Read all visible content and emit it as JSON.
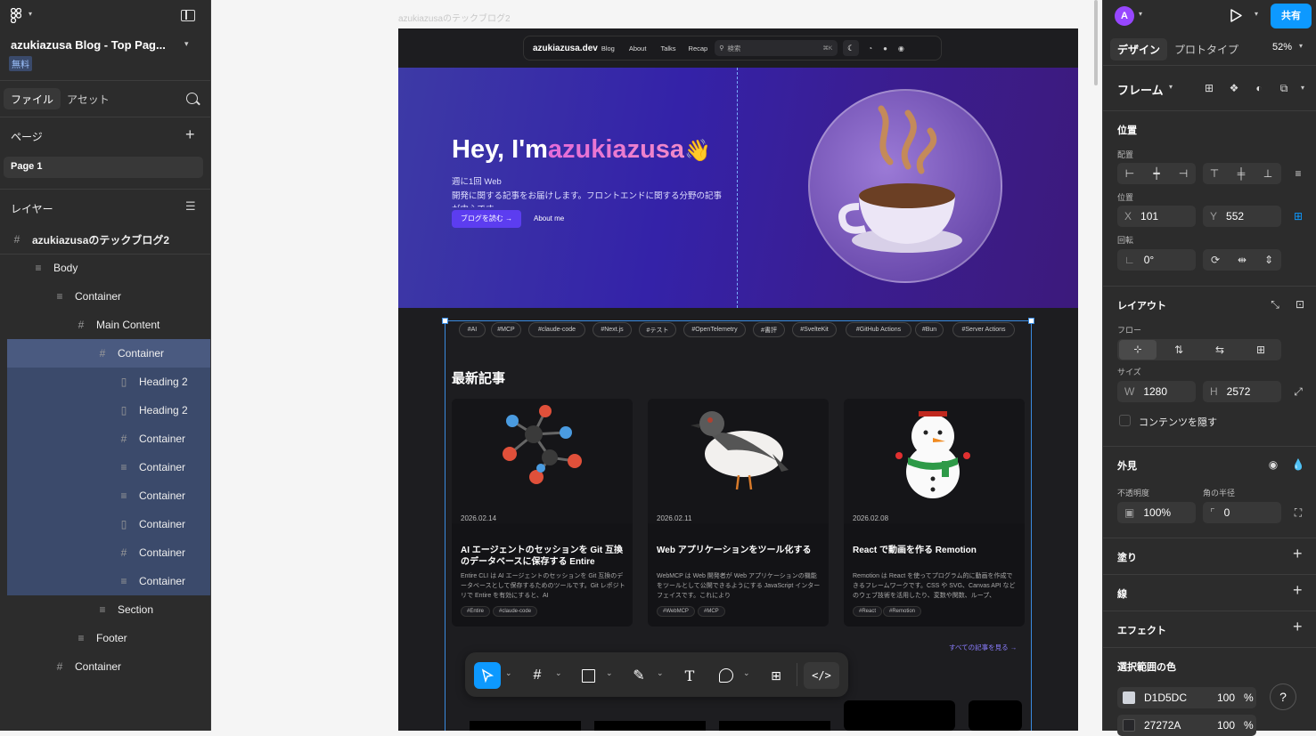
{
  "left": {
    "file_title": "azukiazusa Blog - Top Pag...",
    "plan_badge": "無料",
    "tabs": {
      "file": "ファイル",
      "assets": "アセット"
    },
    "pages_header": "ページ",
    "current_page": "Page 1",
    "layers_header": "レイヤー",
    "layers": [
      {
        "label": "azukiazusaのテックブログ2",
        "icon": "#"
      },
      {
        "label": "Body",
        "icon": "≡"
      },
      {
        "label": "Container",
        "icon": "≡"
      },
      {
        "label": "Main Content",
        "icon": "#"
      },
      {
        "label": "Container",
        "icon": "#"
      },
      {
        "label": "Heading 2",
        "icon": "▯"
      },
      {
        "label": "Heading 2",
        "icon": "▯"
      },
      {
        "label": "Container",
        "icon": "#"
      },
      {
        "label": "Container",
        "icon": "≡"
      },
      {
        "label": "Container",
        "icon": "≡"
      },
      {
        "label": "Container",
        "icon": "▯"
      },
      {
        "label": "Container",
        "icon": "#"
      },
      {
        "label": "Container",
        "icon": "≡"
      },
      {
        "label": "Section",
        "icon": "≡"
      },
      {
        "label": "Footer",
        "icon": "≡"
      },
      {
        "label": "Container",
        "icon": "#"
      }
    ]
  },
  "canvas": {
    "frame_label": "azukiazusaのテックブログ2"
  },
  "site": {
    "brand": "azukiazusa.dev",
    "nav": [
      "Blog",
      "About",
      "Talks",
      "Recap"
    ],
    "search_placeholder": "検索",
    "search_shortcut": "⌘K",
    "hero_greeting": "Hey, I'm",
    "hero_name": "azukiazusa",
    "hero_wave": "👋",
    "hero_desc1": "週に1回 Web",
    "hero_desc2": "開発に関する記事をお届けします。フロントエンドに関する分野の記事",
    "hero_desc3": "が中心です。",
    "cta_primary": "ブログを読む →",
    "cta_secondary": "About me",
    "tags": [
      "#AI",
      "#MCP",
      "#claude-code",
      "#Next.js",
      "#テスト",
      "#OpenTelemetry",
      "#書評",
      "#SvelteKit",
      "#GitHub Actions",
      "#Bun",
      "#Server Actions"
    ],
    "latest_heading": "最新記事",
    "cards": [
      {
        "date": "2026.02.14",
        "title": "AI エージェントのセッションを Git 互換のデータベースに保存する Entire",
        "desc": "Entire CLI は AI エージェントのセッションを Git 互換のデータベースとして保存するためのツールです。Git レポジトリで Entire を有効にすると、AI",
        "tags": [
          "#Entire",
          "#claude-code"
        ]
      },
      {
        "date": "2026.02.11",
        "title": "Web アプリケーションをツール化する",
        "desc": "WebMCP は Web 開発者が Web アプリケーションの機能をツールとして公開できるようにする JavaScript インターフェイスです。これにより",
        "tags": [
          "#WebMCP",
          "#MCP"
        ]
      },
      {
        "date": "2026.02.08",
        "title": "React で動画を作る Remotion",
        "desc": "Remotion は React を使ってプログラム的に動画を作成できるフレームワークです。CSS や SVG、Canvas API などのウェブ技術を活用したり、変数や関数、ループ、",
        "tags": [
          "#React",
          "#Remotion"
        ]
      }
    ],
    "see_all": "すべての記事を見る →"
  },
  "right": {
    "avatar_letter": "A",
    "share_label": "共有",
    "tabs": {
      "design": "デザイン",
      "prototype": "プロトタイプ"
    },
    "zoom": "52%",
    "frame_label": "フレーム",
    "position_header": "位置",
    "align_label": "配置",
    "pos_label": "位置",
    "x_label": "X",
    "x_value": "101",
    "y_label": "Y",
    "y_value": "552",
    "rotation_label": "回転",
    "rotation_value": "0°",
    "layout_header": "レイアウト",
    "flow_label": "フロー",
    "size_label": "サイズ",
    "w_label": "W",
    "w_value": "1280",
    "h_label": "H",
    "h_value": "2572",
    "clip_label": "コンテンツを隠す",
    "appearance_header": "外見",
    "opacity_label": "不透明度",
    "opacity_value": "100%",
    "radius_label": "角の半径",
    "radius_value": "0",
    "fill_header": "塗り",
    "stroke_header": "線",
    "effects_header": "エフェクト",
    "selection_colors_header": "選択範囲の色",
    "colors": [
      {
        "hex": "D1D5DC",
        "opacity": "100",
        "unit": "%",
        "swatch": "#D1D5DC"
      },
      {
        "hex": "27272A",
        "opacity": "100",
        "unit": "%",
        "swatch": "#27272A"
      }
    ],
    "help": "?"
  },
  "colors": {
    "accent": "#0d99ff",
    "selection": "#3b4a6b",
    "hero_name": "#e56bd8"
  }
}
